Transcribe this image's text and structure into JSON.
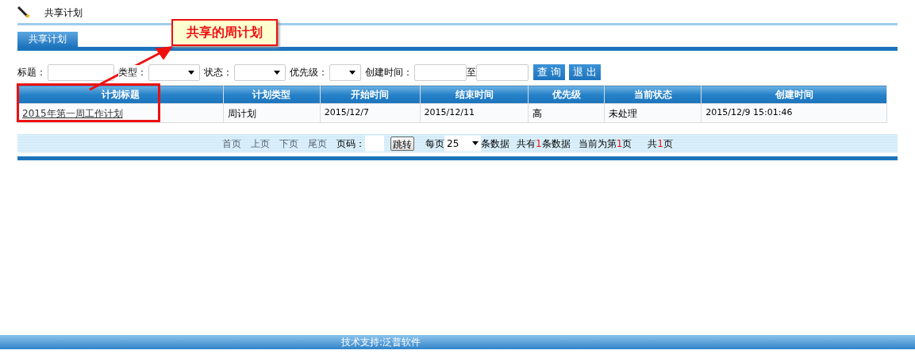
{
  "page_title": "共享计划",
  "tabs": [
    {
      "label": "共享计划",
      "selected": true
    }
  ],
  "filters": [
    {
      "kind": "input",
      "label": "标题："
    },
    {
      "kind": "select",
      "label": "类型："
    },
    {
      "kind": "select",
      "label": "状态："
    },
    {
      "kind": "select",
      "label": "优先级："
    },
    {
      "kind": "range",
      "label": "创建时间：",
      "separator": "至"
    }
  ],
  "buttons": [
    "查 询",
    "退 出"
  ],
  "table": {
    "columns": [
      "计划标题",
      "计划类型",
      "开始时间",
      "结束时间",
      "优先级",
      "当前状态",
      "创建时间"
    ],
    "rows": [
      [
        "2015年第一周工作计划",
        "周计划",
        "2015/12/7",
        "2015/12/11",
        "高",
        "未处理",
        "2015/12/9 15:01:46"
      ]
    ]
  },
  "pager": {
    "links": [
      "首页",
      "上页",
      "下页",
      "尾页"
    ],
    "page_label": "页码：",
    "go_button": "跳转",
    "per_page_label": "每页",
    "per_page": "25",
    "per_page_suffix": "条数据",
    "total": {
      "prefix": "共有",
      "count": "1",
      "suffix": "条数据"
    },
    "current": {
      "prefix": "当前为第",
      "count": "1",
      "suffix": "页"
    },
    "pages": {
      "prefix": "共",
      "count": "1",
      "suffix": "页"
    }
  },
  "callout": {
    "text": "共享的周计划"
  },
  "footer": "技术支持:泛普软件"
}
